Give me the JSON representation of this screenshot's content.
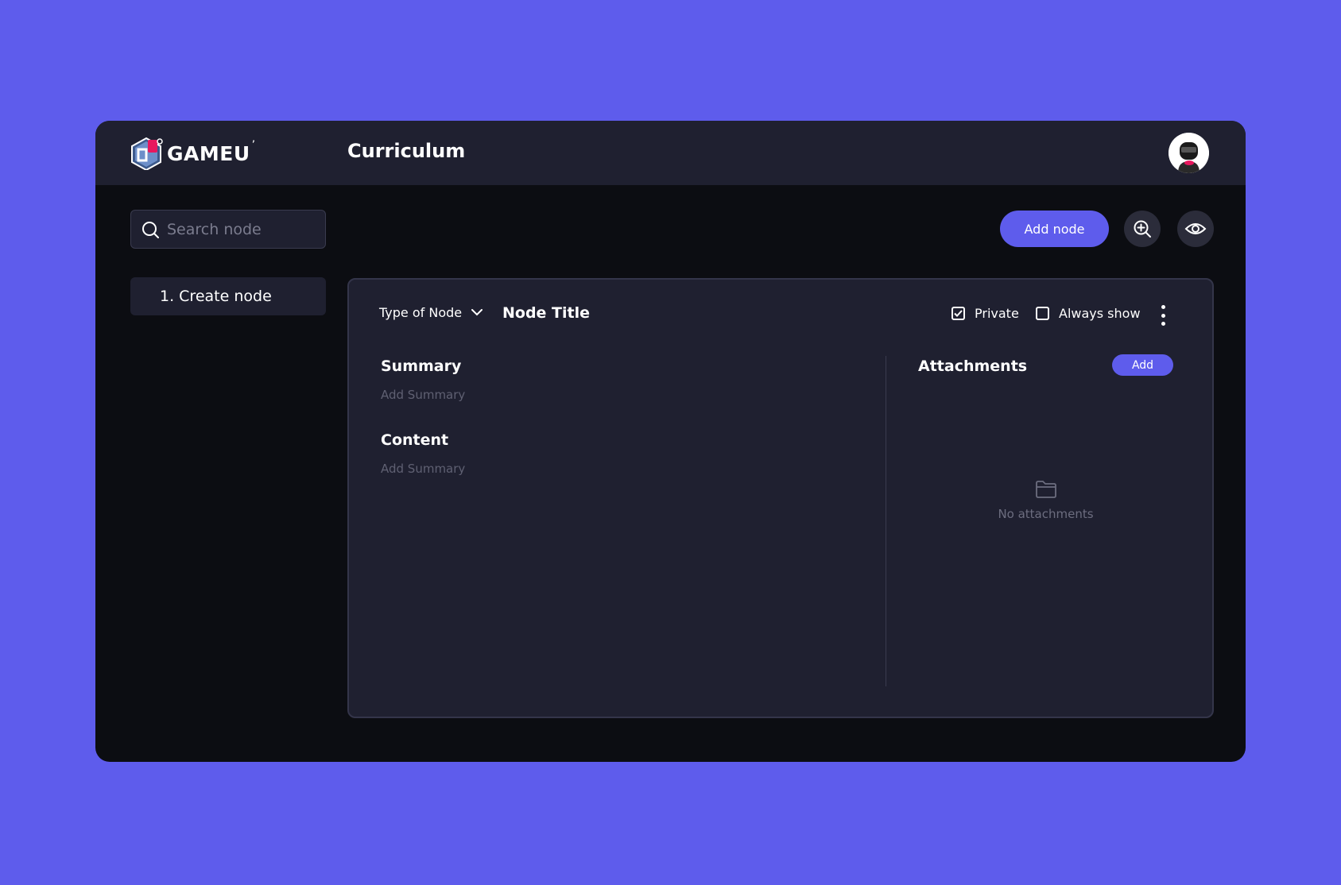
{
  "header": {
    "logo_text": "GAMEU",
    "logo_mark": "GU",
    "page_title": "Curriculum",
    "avatar_icon": "user-avatar-icon"
  },
  "sidebar": {
    "search": {
      "placeholder": "Search node",
      "value": "",
      "icon": "search-icon"
    },
    "items": [
      {
        "label": "1. Create node"
      }
    ]
  },
  "toolbar": {
    "add_node_label": "Add node",
    "zoom_icon": "zoom-in-icon",
    "preview_icon": "eye-icon"
  },
  "editor": {
    "type_select_label": "Type of Node",
    "node_title": "Node Title",
    "private_label": "Private",
    "private_checked": true,
    "always_show_label": "Always show",
    "always_show_checked": false,
    "summary_heading": "Summary",
    "summary_placeholder": "Add Summary",
    "content_heading": "Content",
    "content_placeholder": "Add Summary"
  },
  "attachments": {
    "heading": "Attachments",
    "add_label": "Add",
    "empty_text": "No attachments",
    "empty_icon": "folder-icon"
  },
  "colors": {
    "background": "#5e5cec",
    "app_bg": "#0c0d12",
    "surface": "#1f2030",
    "accent": "#5e5cec",
    "logo_pink": "#e8185e"
  }
}
